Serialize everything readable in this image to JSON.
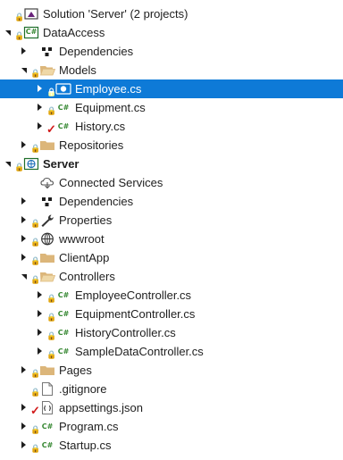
{
  "rows": [
    {
      "label": "Solution 'Server' (2 projects)",
      "icon": "solution-icon",
      "state": "none",
      "lock": "lock-icon",
      "check": false,
      "bold": false,
      "selected": false,
      "level": 0
    },
    {
      "label": "DataAccess",
      "icon": "csharp-project-icon",
      "state": "expanded",
      "lock": "lock-icon",
      "check": false,
      "bold": false,
      "selected": false,
      "level": 0
    },
    {
      "label": "Dependencies",
      "icon": "dependencies-icon",
      "state": "collapsed",
      "lock": "",
      "check": false,
      "bold": false,
      "selected": false,
      "level": 1
    },
    {
      "label": "Models",
      "icon": "folder-open-icon",
      "state": "expanded",
      "lock": "lock-icon",
      "check": false,
      "bold": false,
      "selected": false,
      "level": 1
    },
    {
      "label": "Employee.cs",
      "icon": "csharp-class-file-icon",
      "state": "collapsed",
      "lock": "lock-icon",
      "check": false,
      "bold": false,
      "selected": true,
      "level": 2
    },
    {
      "label": "Equipment.cs",
      "icon": "csharp-file-icon",
      "state": "collapsed",
      "lock": "lock-icon",
      "check": false,
      "bold": false,
      "selected": false,
      "level": 2
    },
    {
      "label": "History.cs",
      "icon": "csharp-file-icon",
      "state": "collapsed",
      "lock": "",
      "check": true,
      "bold": false,
      "selected": false,
      "level": 2
    },
    {
      "label": "Repositories",
      "icon": "folder-icon",
      "state": "collapsed",
      "lock": "lock-icon",
      "check": false,
      "bold": false,
      "selected": false,
      "level": 1
    },
    {
      "label": "Server",
      "icon": "web-project-icon",
      "state": "expanded",
      "lock": "lock-icon",
      "check": false,
      "bold": true,
      "selected": false,
      "level": 0
    },
    {
      "label": "Connected Services",
      "icon": "connected-services-icon",
      "state": "none",
      "lock": "",
      "check": false,
      "bold": false,
      "selected": false,
      "level": 1
    },
    {
      "label": "Dependencies",
      "icon": "dependencies-icon",
      "state": "collapsed",
      "lock": "",
      "check": false,
      "bold": false,
      "selected": false,
      "level": 1
    },
    {
      "label": "Properties",
      "icon": "wrench-icon",
      "state": "collapsed",
      "lock": "lock-icon",
      "check": false,
      "bold": false,
      "selected": false,
      "level": 1
    },
    {
      "label": "wwwroot",
      "icon": "globe-icon",
      "state": "collapsed",
      "lock": "lock-icon",
      "check": false,
      "bold": false,
      "selected": false,
      "level": 1
    },
    {
      "label": "ClientApp",
      "icon": "folder-icon",
      "state": "collapsed",
      "lock": "lock-icon",
      "check": false,
      "bold": false,
      "selected": false,
      "level": 1
    },
    {
      "label": "Controllers",
      "icon": "folder-open-icon",
      "state": "expanded",
      "lock": "lock-icon",
      "check": false,
      "bold": false,
      "selected": false,
      "level": 1
    },
    {
      "label": "EmployeeController.cs",
      "icon": "csharp-file-icon",
      "state": "collapsed",
      "lock": "lock-icon",
      "check": false,
      "bold": false,
      "selected": false,
      "level": 2
    },
    {
      "label": "EquipmentController.cs",
      "icon": "csharp-file-icon",
      "state": "collapsed",
      "lock": "lock-icon",
      "check": false,
      "bold": false,
      "selected": false,
      "level": 2
    },
    {
      "label": "HistoryController.cs",
      "icon": "csharp-file-icon",
      "state": "collapsed",
      "lock": "lock-icon",
      "check": false,
      "bold": false,
      "selected": false,
      "level": 2
    },
    {
      "label": "SampleDataController.cs",
      "icon": "csharp-file-icon",
      "state": "collapsed",
      "lock": "lock-icon",
      "check": false,
      "bold": false,
      "selected": false,
      "level": 2
    },
    {
      "label": "Pages",
      "icon": "folder-icon",
      "state": "collapsed",
      "lock": "lock-icon",
      "check": false,
      "bold": false,
      "selected": false,
      "level": 1
    },
    {
      "label": ".gitignore",
      "icon": "text-file-icon",
      "state": "none",
      "lock": "lock-icon",
      "check": false,
      "bold": false,
      "selected": false,
      "level": 1
    },
    {
      "label": "appsettings.json",
      "icon": "json-file-icon",
      "state": "collapsed",
      "lock": "",
      "check": true,
      "bold": false,
      "selected": false,
      "level": 1
    },
    {
      "label": "Program.cs",
      "icon": "csharp-file-icon",
      "state": "collapsed",
      "lock": "lock-icon",
      "check": false,
      "bold": false,
      "selected": false,
      "level": 1
    },
    {
      "label": "Startup.cs",
      "icon": "csharp-file-icon",
      "state": "collapsed",
      "lock": "lock-icon",
      "check": false,
      "bold": false,
      "selected": false,
      "level": 1
    }
  ],
  "icon_text": {
    "csharp_badge": "C#"
  },
  "colors": {
    "selection": "#0e7ad7",
    "folder": "#dcb67a",
    "csharp": "#368832",
    "project_border": "#1f6f2b",
    "lock": "#4a8ec9",
    "check": "#d11a1a"
  }
}
